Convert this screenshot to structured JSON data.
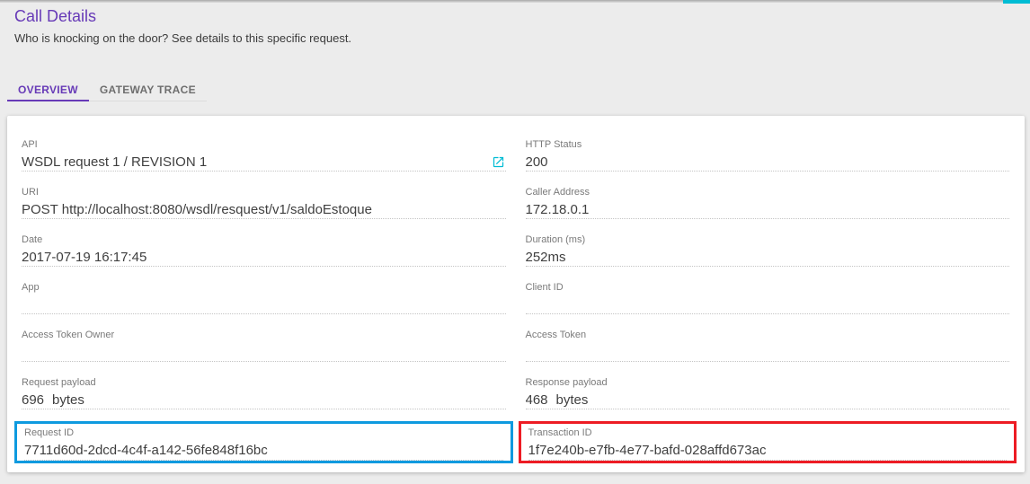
{
  "page": {
    "title": "Call Details",
    "subtitle": "Who is knocking on the door? See details to this specific request."
  },
  "tabs": {
    "overview": "OVERVIEW",
    "gateway_trace": "GATEWAY TRACE",
    "active_tab": "OVERVIEW"
  },
  "fields": {
    "left": [
      {
        "label": "API",
        "value": "WSDL request 1 / REVISION 1",
        "icon": "open-in-new-icon"
      },
      {
        "label": "URI",
        "value": "POST http://localhost:8080/wsdl/resquest/v1/saldoEstoque"
      },
      {
        "label": "Date",
        "value": "2017-07-19 16:17:45"
      },
      {
        "label": "App",
        "value": ""
      },
      {
        "label": "Access Token Owner",
        "value": ""
      },
      {
        "label": "Request payload",
        "value": "696",
        "unit": "bytes"
      },
      {
        "label": "Request ID",
        "value": "7711d60d-2dcd-4c4f-a142-56fe848f16bc",
        "highlight": "blue"
      }
    ],
    "right": [
      {
        "label": "HTTP Status",
        "value": "200"
      },
      {
        "label": "Caller Address",
        "value": "172.18.0.1"
      },
      {
        "label": "Duration (ms)",
        "value": "252ms"
      },
      {
        "label": "Client ID",
        "value": ""
      },
      {
        "label": "Access Token",
        "value": ""
      },
      {
        "label": "Response payload",
        "value": "468",
        "unit": "bytes"
      },
      {
        "label": "Transaction ID",
        "value": "1f7e240b-e7fb-4e77-bafd-028affd673ac",
        "highlight": "red"
      }
    ]
  },
  "colors": {
    "accent": "#673ab7",
    "cyan": "#00bcd4",
    "hl-blue": "#0e9adf",
    "hl-red": "#ed1c24"
  }
}
